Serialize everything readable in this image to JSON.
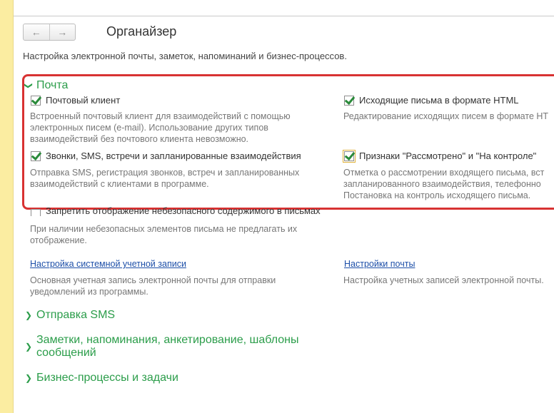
{
  "header": {
    "title": "Органайзер",
    "subtitle": "Настройка электронной почты, заметок, напоминаний и бизнес-процессов."
  },
  "nav": {
    "back_icon": "arrow-left-icon",
    "forward_icon": "arrow-right-icon"
  },
  "mail": {
    "title": "Почта",
    "options": [
      {
        "label": "Почтовый клиент",
        "checked": true,
        "desc": [
          "Встроенный почтовый клиент для взаимодействий с помощью",
          "электронных писем (e-mail). Использование других типов",
          "взаимодействий без почтового клиента невозможно."
        ]
      },
      {
        "label": "Исходящие письма в формате HTML",
        "checked": true,
        "desc": [
          "Редактирование исходящих писем в формате HT"
        ]
      },
      {
        "label": "Звонки, SMS, встречи и запланированные взаимодействия",
        "checked": true,
        "desc": [
          "Отправка SMS, регистрация звонков, встреч и запланированных",
          "взаимодействий с клиентами в программе."
        ]
      },
      {
        "label": "Признаки \"Рассмотрено\" и \"На контроле\"",
        "checked": true,
        "desc": [
          "Отметка о рассмотрении входящего письма, вст",
          "запланированного взаимодействия, телефонно",
          "Постановка на контроль исходящего письма."
        ]
      },
      {
        "label": "Запретить отображение небезопасного содержимого в письмах",
        "checked": false,
        "desc": [
          "При наличии небезопасных элементов письма не предлагать их",
          "отображение."
        ]
      }
    ],
    "links": [
      {
        "label": "Настройка системной учетной записи",
        "desc": [
          "Основная учетная запись электронной почты для отправки",
          "уведомлений из программы."
        ]
      },
      {
        "label": "Настройки почты",
        "desc": [
          "Настройка учетных записей электронной почты."
        ]
      }
    ]
  },
  "sections": [
    {
      "title": "Отправка SMS"
    },
    {
      "title": "Заметки, напоминания, анкетирование, шаблоны",
      "title2": "сообщений"
    },
    {
      "title": "Бизнес-процессы и задачи"
    }
  ]
}
